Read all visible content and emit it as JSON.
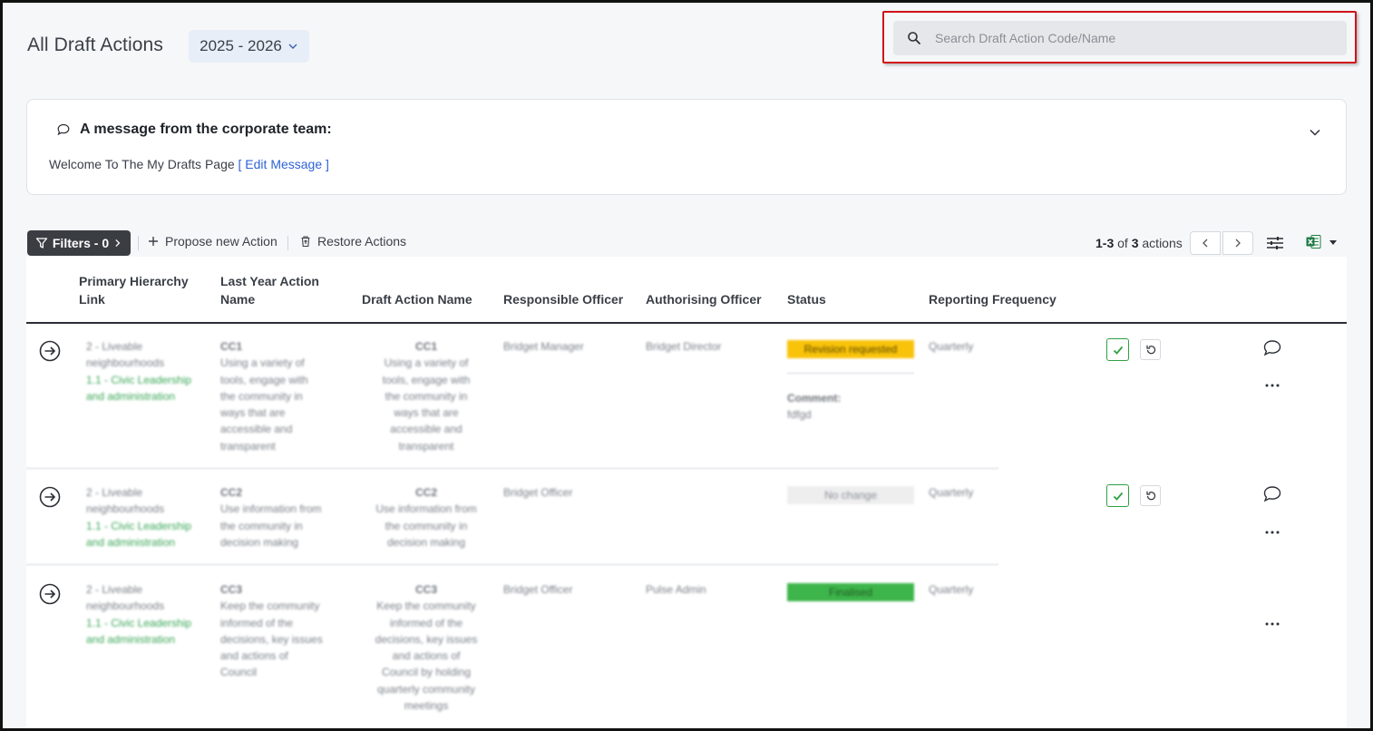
{
  "header": {
    "title": "All Draft Actions",
    "year": "2025 - 2026",
    "search_placeholder": "Search Draft Action Code/Name"
  },
  "message": {
    "title": "A message from the corporate team:",
    "body": "Welcome To The My Drafts Page",
    "edit_link": "[ Edit Message ]"
  },
  "toolbar": {
    "filters_label": "Filters - 0",
    "propose_label": "Propose new Action",
    "restore_label": "Restore Actions",
    "count_range": "1-3",
    "count_of": "of",
    "count_total": "3",
    "count_unit": "actions"
  },
  "columns": {
    "primary_l1": "Primary Hierarchy",
    "primary_l2": "Link",
    "last_l1": "Last Year Action",
    "last_l2": "Name",
    "draft": "Draft Action Name",
    "responsible": "Responsible Officer",
    "authorising": "Authorising Officer",
    "status": "Status",
    "frequency": "Reporting Frequency"
  },
  "rows": [
    {
      "hier": [
        "2 - Liveable",
        "neighbourhoods"
      ],
      "hier_link": [
        "1.1 - Civic Leadership",
        "and administration"
      ],
      "last_code": "CC1",
      "last_desc": [
        "Using a variety of",
        "tools, engage with",
        "the community in",
        "ways that are",
        "accessible and",
        "transparent"
      ],
      "draft_code": "CC1",
      "draft_desc": [
        "Using a variety of",
        "tools, engage with",
        "the community in",
        "ways that are",
        "accessible and",
        "transparent"
      ],
      "responsible": "Bridget Manager",
      "authorising": "Bridget Director",
      "status": "Revision requested",
      "status_bg": "#f9c30a",
      "status_fg": "#5a4600",
      "comment_label": "Comment:",
      "comment": "fdfgd",
      "frequency": "Quarterly"
    },
    {
      "hier": [
        "2 - Liveable",
        "neighbourhoods"
      ],
      "hier_link": [
        "1.1 - Civic Leadership",
        "and administration"
      ],
      "last_code": "CC2",
      "last_desc": [
        "Use information from",
        "the community in",
        "decision making"
      ],
      "draft_code": "CC2",
      "draft_desc": [
        "Use information from",
        "the community in",
        "decision making"
      ],
      "responsible": "Bridget Officer",
      "authorising": "",
      "status": "No change",
      "status_bg": "#eeeeee",
      "status_fg": "#8a8e96",
      "frequency": "Quarterly"
    },
    {
      "hier": [
        "2 - Liveable",
        "neighbourhoods"
      ],
      "hier_link": [
        "1.1 - Civic Leadership",
        "and administration"
      ],
      "last_code": "CC3",
      "last_desc": [
        "Keep the community",
        "informed of the",
        "decisions, key issues",
        "and actions of",
        "Council"
      ],
      "draft_code": "CC3",
      "draft_desc": [
        "Keep the community",
        "informed of the",
        "decisions, key issues",
        "and actions of",
        "Council by holding",
        "quarterly community",
        "meetings"
      ],
      "responsible": "Bridget Officer",
      "authorising": "Pulse Admin",
      "status": "Finalised",
      "status_bg": "#3db54a",
      "status_fg": "#1f5a25",
      "frequency": "Quarterly"
    }
  ]
}
